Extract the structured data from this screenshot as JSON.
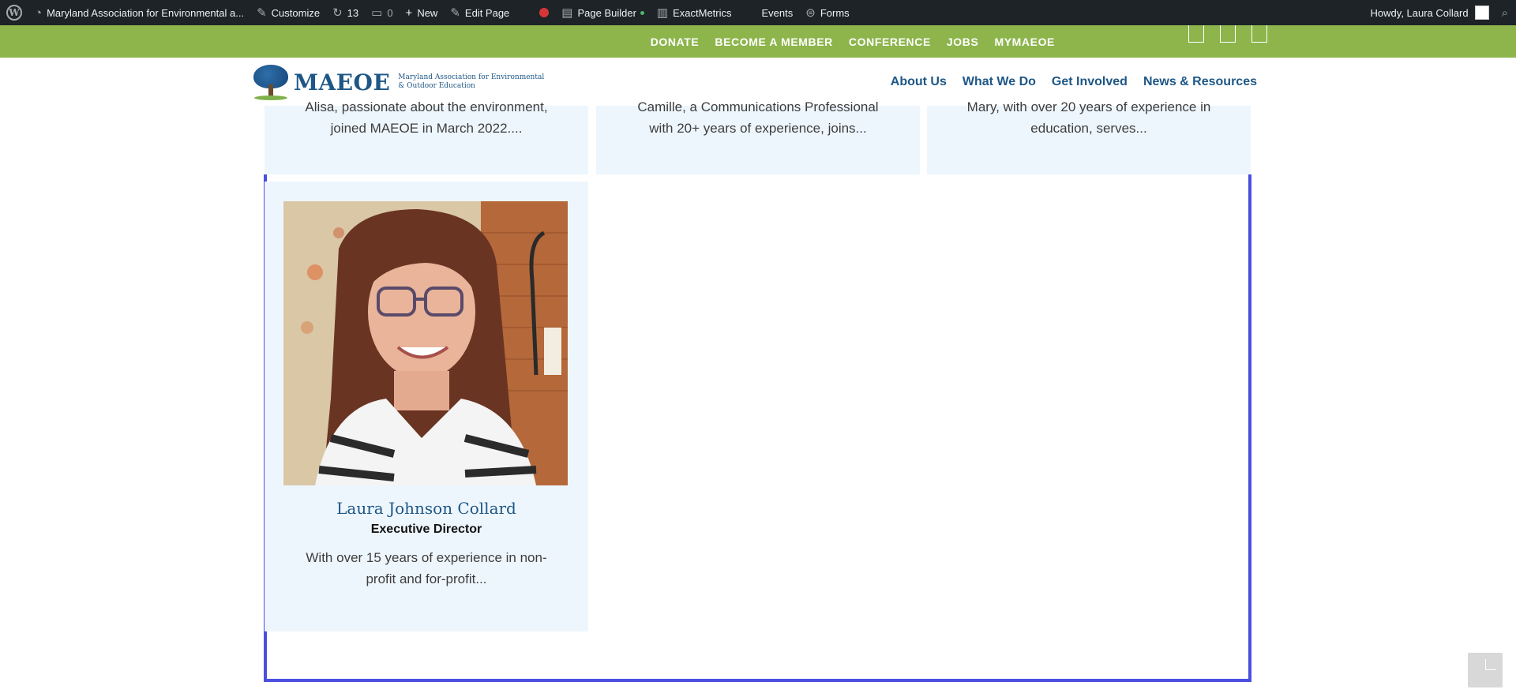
{
  "adminbar": {
    "site_name": "Maryland Association for Environmental a...",
    "customize": "Customize",
    "updates_count": "13",
    "comments_count": "0",
    "new": "New",
    "edit_page": "Edit Page",
    "page_builder": "Page Builder",
    "exactmetrics": "ExactMetrics",
    "events": "Events",
    "forms": "Forms",
    "howdy": "Howdy, Laura Collard"
  },
  "topbar": {
    "links": [
      "DONATE",
      "BECOME A MEMBER",
      "CONFERENCE",
      "JOBS",
      "MYMAEOE"
    ]
  },
  "header": {
    "logo_text": "MAEOE",
    "logo_sub_line1": "Maryland Association for Environmental",
    "logo_sub_line2": "& Outdoor Education",
    "nav": [
      "About Us",
      "What We Do",
      "Get Involved",
      "News & Resources"
    ]
  },
  "staff_cards_top": [
    {
      "desc_line1": "Alisa, passionate about the environment,",
      "desc_line2": "joined MAEOE in March 2022...."
    },
    {
      "desc_line1": "Camille, a Communications Professional",
      "desc_line2": "with 20+ years of experience, joins..."
    },
    {
      "desc_line1": "Mary, with over 20 years of experience in",
      "desc_line2": "education, serves..."
    }
  ],
  "featured_card": {
    "name": "Laura Johnson Collard",
    "role": "Executive Director",
    "desc_line1": "With over 15 years of experience in non-",
    "desc_line2": "profit and for-profit..."
  }
}
